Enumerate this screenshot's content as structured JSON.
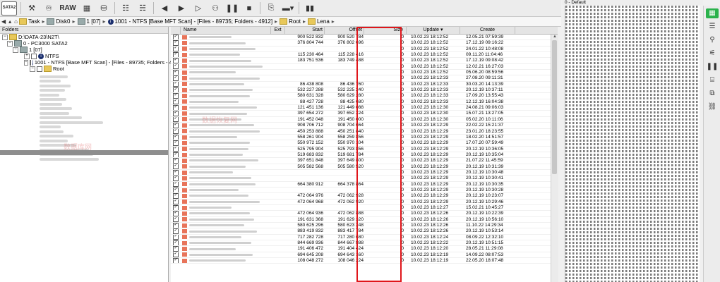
{
  "toolbar": {
    "sata_label": "SATA2",
    "raw_label": "RAW"
  },
  "breadcrumb": {
    "task": "Task",
    "disk": "Disk0",
    "partition": "1 [07]",
    "scan": "1001 - NTFS [Base MFT Scan] - [Files - 89735; Folders - 4912]",
    "root": "Root",
    "folder": "Lena"
  },
  "tree": {
    "header": "Folders",
    "nodes": [
      {
        "label": "D:\\DATA-23\\N2T\\",
        "indent": 0
      },
      {
        "label": "0 - PC3000 SATA2",
        "indent": 1
      },
      {
        "label": "1 [07]",
        "indent": 2
      },
      {
        "label": "NTFS",
        "indent": 3
      },
      {
        "label": "1001 - NTFS [Base MFT Scan] - [Files - 89735; Folders - 4912]",
        "indent": 3
      },
      {
        "label": "Root",
        "indent": 4
      }
    ]
  },
  "grid": {
    "columns": [
      "Name",
      "Ext",
      "Start",
      "Offset",
      "Size",
      "Update",
      "Create"
    ],
    "rows": [
      [
        "900 522 832",
        "900 520 784",
        "0",
        "10.02.23 18:12:52",
        "12.05.21 07:59:39"
      ],
      [
        "376 804 744",
        "376 802 696",
        "0",
        "10.02.23 18:12:52",
        "17.12.19 09:16:22"
      ],
      [
        "",
        "",
        "0",
        "10.02.23 18:12:52",
        "24.01.22 10:48:08"
      ],
      [
        "115 230 464",
        "115 228 416",
        "0",
        "10.02.23 18:12:52",
        "09.11.20 11:04:46"
      ],
      [
        "183 751 536",
        "183 749 488",
        "0",
        "10.02.23 18:12:52",
        "17.12.19 09:08:42"
      ],
      [
        "",
        "",
        "0",
        "10.02.23 18:12:52",
        "12.02.21 16:27:03"
      ],
      [
        "",
        "",
        "0",
        "10.02.23 18:12:52",
        "05.06.20 08:59:56"
      ],
      [
        "",
        "",
        "0",
        "10.02.23 18:12:33",
        "27.08.20 09:11:31"
      ],
      [
        "86 438 808",
        "86 436 760",
        "0",
        "10.02.23 18:12:33",
        "30.03.20 14:13:39"
      ],
      [
        "532 227 288",
        "532 225 240",
        "0",
        "10.02.23 18:12:33",
        "20.12.19 10:37:11"
      ],
      [
        "580 631 328",
        "580 629 280",
        "0",
        "10.02.23 18:12:33",
        "17.09.20 13:55:43"
      ],
      [
        "88 427 728",
        "88 425 680",
        "0",
        "10.02.23 18:12:33",
        "12.12.19 16:04:38"
      ],
      [
        "121 451 136",
        "121 449 088",
        "0",
        "10.02.23 18:12:30",
        "24.08.21 09:06:03"
      ],
      [
        "397 654 272",
        "397 652 224",
        "0",
        "10.02.23 18:12:30",
        "15.07.21 13:27:05"
      ],
      [
        "191 452 048",
        "191 450 000",
        "0",
        "10.02.23 18:12:30",
        "05.02.20 10:11:06"
      ],
      [
        "908 706 712",
        "908 704 664",
        "0",
        "10.02.23 18:12:29",
        "22.02.22 15:21:37"
      ],
      [
        "450 253 888",
        "450 251 840",
        "0",
        "10.02.23 18:12:29",
        "23.01.20 18:23:55"
      ],
      [
        "558 261 904",
        "558 259 856",
        "0",
        "10.02.23 18:12:29",
        "18.02.20 14:51:57"
      ],
      [
        "550 972 152",
        "550 970 104",
        "0",
        "10.02.23 18:12:29",
        "17.07.20 07:59:49"
      ],
      [
        "525 795 904",
        "525 793 856",
        "0",
        "10.02.23 18:12:29",
        "20.12.19 10:36:05"
      ],
      [
        "519 683 832",
        "519 681 784",
        "0",
        "10.02.23 18:12:29",
        "20.12.19 10:35:04"
      ],
      [
        "397 651 848",
        "397 649 800",
        "0",
        "10.02.23 18:12:29",
        "21.07.22 11:45:59"
      ],
      [
        "505 582 568",
        "505 580 520",
        "0",
        "10.02.23 18:12:29",
        "20.12.19 10:31:39"
      ],
      [
        "",
        "",
        "0",
        "10.02.23 18:12:29",
        "20.12.19 10:30:48"
      ],
      [
        "",
        "",
        "0",
        "10.02.23 18:12:29",
        "20.12.19 10:30:41"
      ],
      [
        "664 380 912",
        "664 378 864",
        "0",
        "10.02.23 18:12:29",
        "20.12.19 10:30:35"
      ],
      [
        "",
        "",
        "0",
        "10.02.23 18:12:29",
        "20.12.19 10:30:28"
      ],
      [
        "472 064 976",
        "472 062 928",
        "0",
        "10.02.23 18:12:29",
        "20.12.19 10:23:07"
      ],
      [
        "472 064 968",
        "472 062 920",
        "0",
        "10.02.23 18:12:29",
        "20.12.19 10:29:46"
      ],
      [
        "",
        "",
        "0",
        "10.02.23 18:12:27",
        "15.02.21 10:45:27"
      ],
      [
        "472 064 936",
        "472 062 888",
        "0",
        "10.02.23 18:12:26",
        "20.12.19 10:22:39"
      ],
      [
        "191 631 368",
        "191 629 320",
        "0",
        "10.02.23 18:12:26",
        "20.12.19 10:56:10"
      ],
      [
        "580 625 296",
        "580 623 248",
        "0",
        "10.02.23 18:12:26",
        "11.10.22 14:29:34"
      ],
      [
        "883 419 832",
        "883 417 784",
        "0",
        "10.02.23 18:12:26",
        "20.12.19 10:53:14"
      ],
      [
        "717 282 728",
        "717 280 680",
        "0",
        "10.02.23 18:12:24",
        "08.09.22 12:32:10"
      ],
      [
        "844 669 936",
        "844 667 888",
        "0",
        "10.02.23 18:12:22",
        "20.12.19 10:51:15"
      ],
      [
        "191 406 472",
        "191 404 424",
        "0",
        "10.02.23 18:12:20",
        "28.05.21 11:29:08"
      ],
      [
        "694 645 208",
        "694 643 160",
        "0",
        "10.02.23 18:12:19",
        "14.09.22 08:07:53"
      ],
      [
        "108 048 272",
        "108 046 224",
        "0",
        "10.02.23 18:12:19",
        "22.05.20 18:07:48"
      ]
    ]
  },
  "map": {
    "title": "0 - Default"
  }
}
